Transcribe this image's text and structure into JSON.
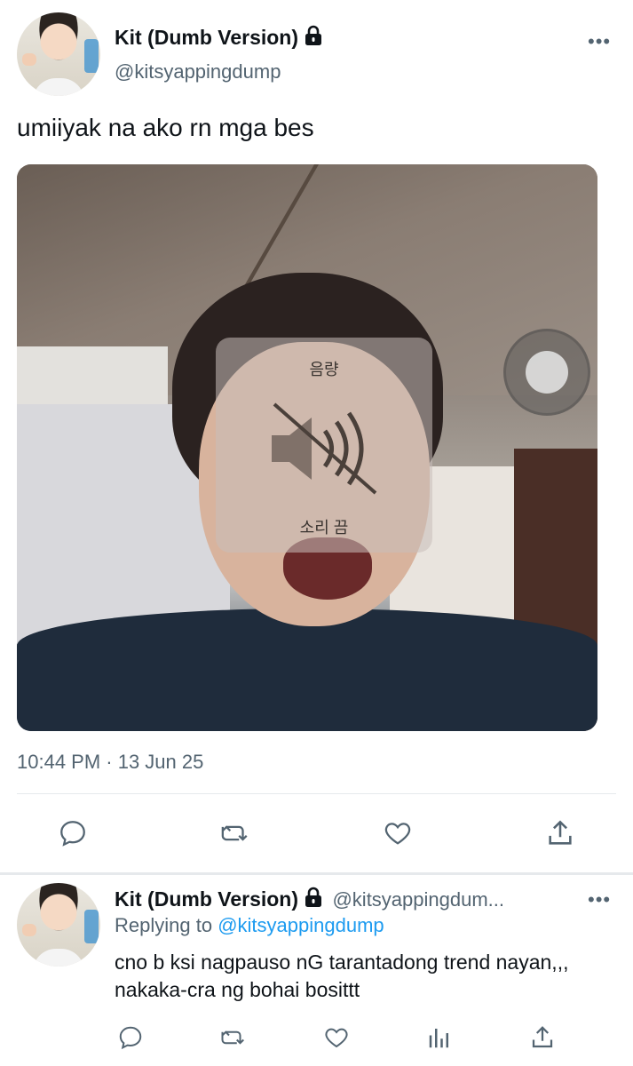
{
  "main_tweet": {
    "author_name": "Kit (Dumb Version)",
    "author_handle": "@kitsyappingdump",
    "text": "umiiyak na ako rn mga bes",
    "media": {
      "osd_title": "음량",
      "osd_status": "소리 끔",
      "icon": "speaker-muted-icon"
    },
    "timestamp": "10:44 PM · 13 Jun 25",
    "actions": [
      "reply-icon",
      "retweet-icon",
      "like-icon",
      "share-icon"
    ]
  },
  "reply_tweet": {
    "author_name": "Kit (Dumb Version)",
    "author_handle": "@kitsyappingdum...",
    "replying_prefix": "Replying to",
    "replying_to": "@kitsyappingdump",
    "text": "cno b ksi nagpauso nG tarantadong trend nayan,,, nakaka-cra ng bohai bosittt",
    "actions": [
      "reply-icon",
      "retweet-icon",
      "like-icon",
      "analytics-icon",
      "share-icon"
    ]
  },
  "colors": {
    "text": "#0f1419",
    "secondary": "#536471",
    "link": "#1d9bf0",
    "divider": "#e6e9ec"
  }
}
